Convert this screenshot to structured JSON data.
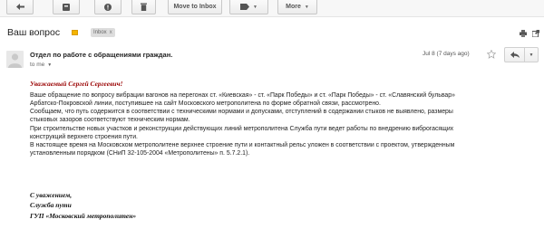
{
  "toolbar": {
    "back_icon": "arrow-left-icon",
    "archive_icon": "archive-icon",
    "spam_icon": "report-spam-icon",
    "delete_icon": "trash-icon",
    "move_label": "Move to Inbox",
    "labels_icon": "label-tag-icon",
    "more_label": "More"
  },
  "subject": {
    "title": "Ваш вопрос",
    "label_color": "#f4b400",
    "tag": "Inbox",
    "tag_close": "x",
    "print_icon": "print-icon",
    "newwindow_icon": "new-window-icon"
  },
  "message": {
    "sender": "Отдел по работе с обращениями граждан.",
    "to": "to me",
    "date": "Jul 8 (7 days ago)",
    "star_icon": "star-icon",
    "reply_icon": "reply-icon"
  },
  "body": {
    "greeting": "Уважаемый Сергей Сергеевич!",
    "lines": [
      "      Ваше обращение по вопросу вибрации вагонов на перегонах ст. «Киевская» - ст. «Парк Победы» и ст. «Парк Победы» - ст. «Славянский бульвар»",
      "Арбатско-Покровской линии, поступившее на сайт Московского метрополитена по форме обратной связи, рассмотрено.",
      "Сообщаем, что путь содержится в соответствии с техническими нормами и допусками, отступлений в содержании стыков не выявлено, размеры",
      "стыковых зазоров соответствуют техническим нормам.",
      "При строительстве новых участков и реконструкции действующих линий метрополитена Служба пути ведет работы по внедрению виброгасящих",
      "конструкций верхнего строения пути.",
      "В настоящее время на Московском метрополитене верхнее строение пути и контактный рельс уложен в соответствии с проектом, утвержденным",
      "установленным порядком (СНиП 32-105-2004 «Метрополитены» п. 5.7.2.1)."
    ],
    "signature": [
      "С уважением,",
      "Служба пути",
      "ГУП «Московский метрополитен»"
    ]
  }
}
